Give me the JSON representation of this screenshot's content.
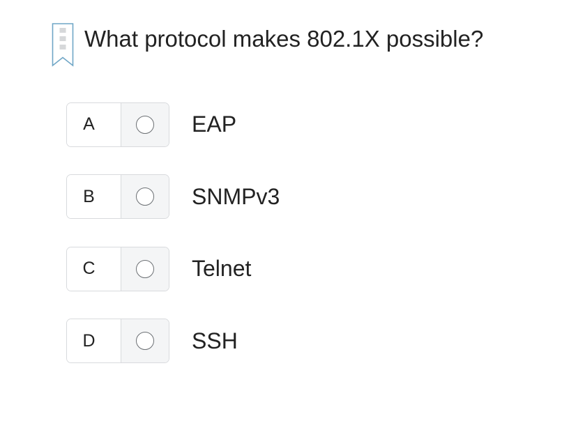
{
  "question": {
    "text": "What protocol makes 802.1X possible?",
    "bookmark_icon": "bookmark-icon"
  },
  "options": [
    {
      "letter": "A",
      "text": "EAP"
    },
    {
      "letter": "B",
      "text": "SNMPv3"
    },
    {
      "letter": "C",
      "text": "Telnet"
    },
    {
      "letter": "D",
      "text": "SSH"
    }
  ],
  "colors": {
    "bookmark_stroke": "#6fa6c6",
    "bookmark_dots": "#d6d8da",
    "border": "#d8dadd",
    "radio_cell_bg": "#f4f5f6",
    "text": "#222222"
  }
}
